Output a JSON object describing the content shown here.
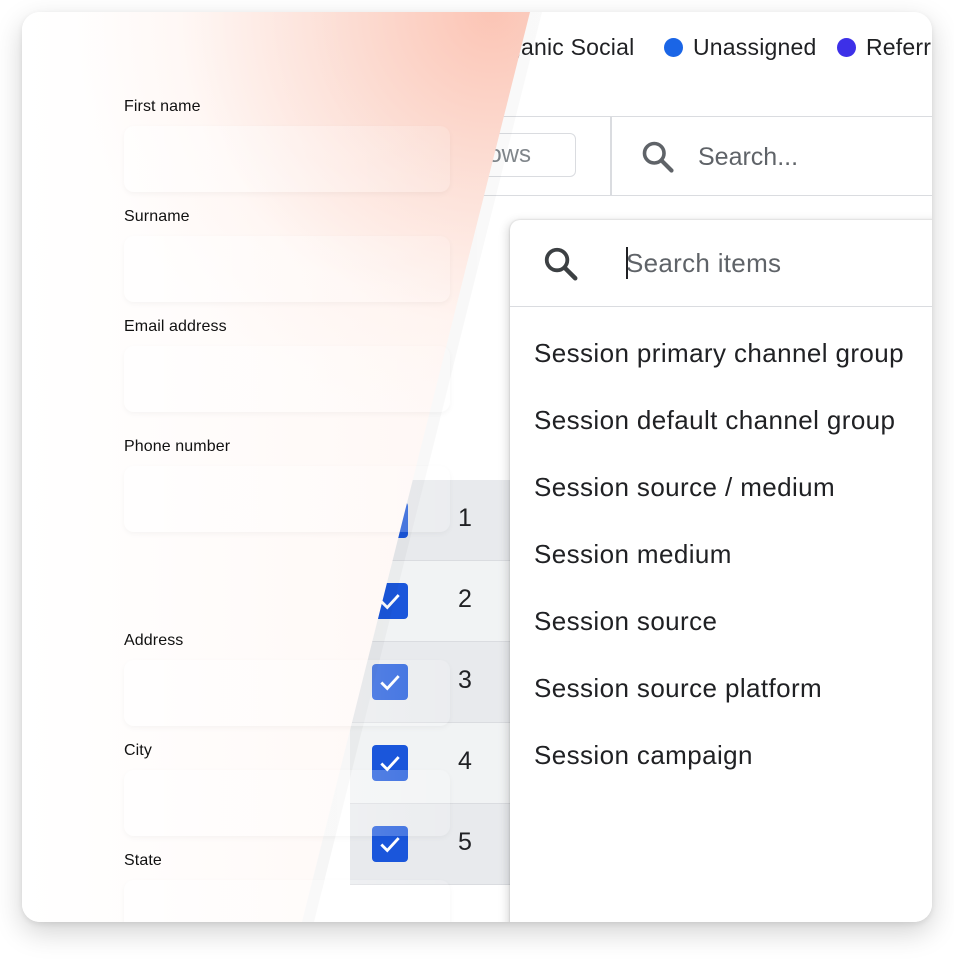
{
  "legend": {
    "items": [
      {
        "label": "ganic Social",
        "color": ""
      },
      {
        "label": "Unassigned",
        "color": "#1a65e6"
      },
      {
        "label": "Referra",
        "color": "#3d30e8"
      }
    ]
  },
  "toolbar": {
    "rows_label": "ows",
    "search_label": "Search..."
  },
  "table": {
    "rows": [
      {
        "num": "1",
        "checked": true
      },
      {
        "num": "2",
        "checked": true
      },
      {
        "num": "3",
        "checked": true
      },
      {
        "num": "4",
        "checked": true
      },
      {
        "num": "5",
        "checked": true
      }
    ]
  },
  "dropdown": {
    "search_placeholder": "Search items",
    "items": [
      "Session primary channel group",
      "Session default channel group",
      "Session source / medium",
      "Session medium",
      "Session source",
      "Session source platform",
      "Session campaign"
    ]
  },
  "form": {
    "first_name_label": "First name",
    "surname_label": "Surname",
    "email_label": "Email address",
    "phone_label": "Phone number",
    "address_label": "Address",
    "city_label": "City",
    "state_label": "State"
  },
  "colors": {
    "checkbox": "#1a56db",
    "accent_gradient": "#fab4a0"
  }
}
